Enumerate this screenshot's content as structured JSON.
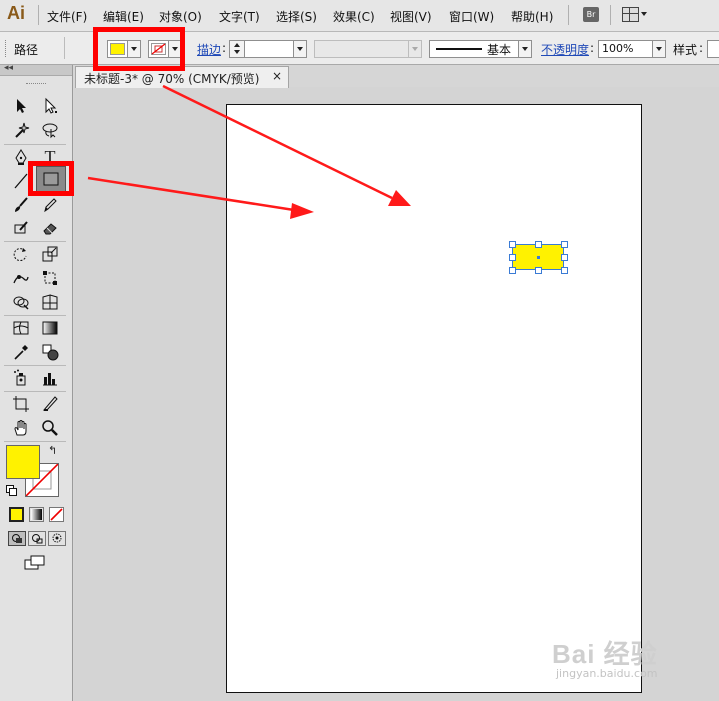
{
  "app": {
    "logo": "Ai"
  },
  "menubar": {
    "items": [
      "文件(F)",
      "编辑(E)",
      "对象(O)",
      "文字(T)",
      "选择(S)",
      "效果(C)",
      "视图(V)",
      "窗口(W)",
      "帮助(H)"
    ],
    "bridge_label": "Br"
  },
  "control_bar": {
    "selection_type": "路径",
    "fill_color": "#fff200",
    "stroke_label": "描边",
    "stroke_weight": "",
    "brush_value": "",
    "profile_value": "基本",
    "opacity_label": "不透明度",
    "opacity_value": "100%",
    "style_label": "样式"
  },
  "document": {
    "tab_title": "未标题-3* @ 70% (CMYK/预览)",
    "close_glyph": "×"
  },
  "toolbox": {
    "fill_color": "#fff200",
    "stroke_color": "none"
  },
  "watermark": {
    "brand": "Bai 经验",
    "url": "jingyan.baidu.com"
  },
  "annotation_color": "#ff0000"
}
